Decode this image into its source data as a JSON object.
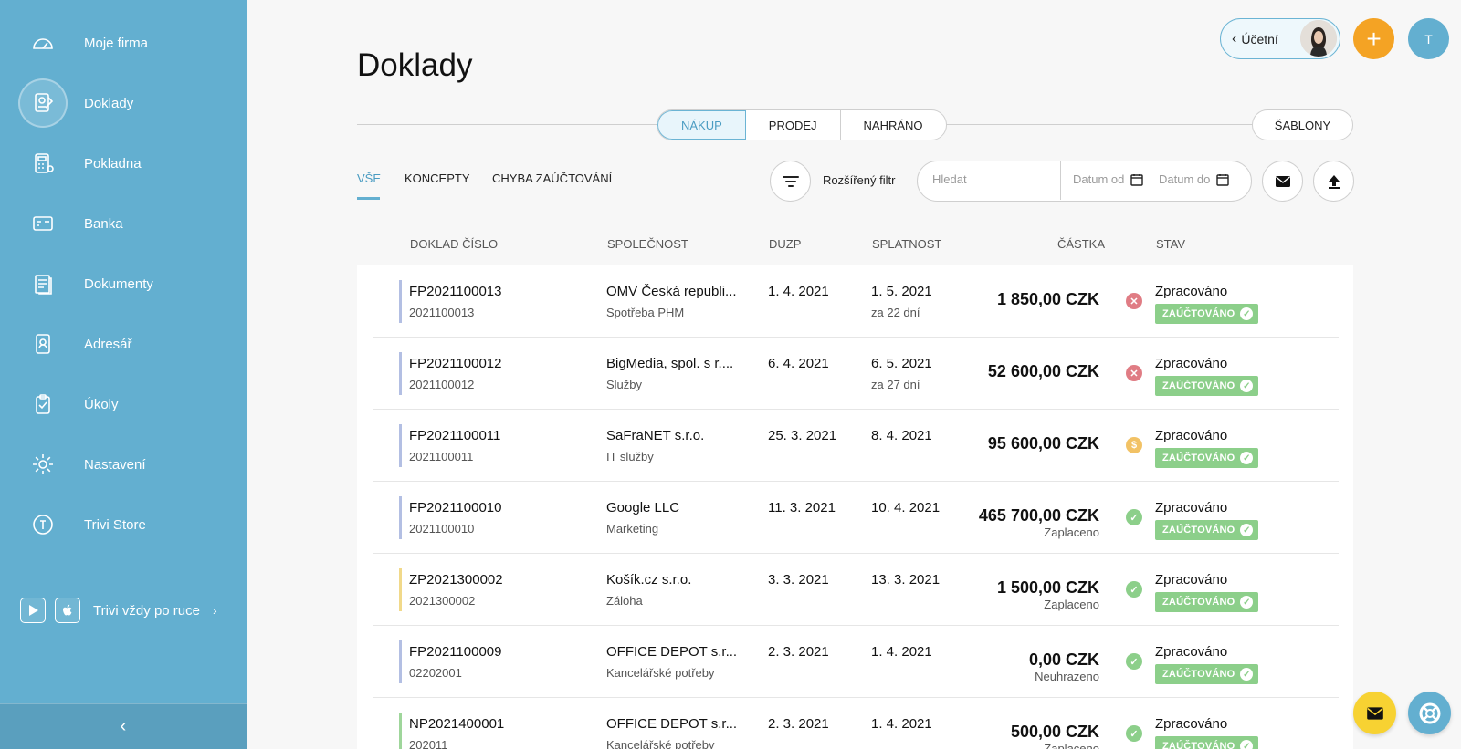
{
  "sidebar": {
    "items": [
      {
        "label": "Moje firma",
        "icon": "gauge-icon"
      },
      {
        "label": "Doklady",
        "icon": "document-icon"
      },
      {
        "label": "Pokladna",
        "icon": "cash-register-icon"
      },
      {
        "label": "Banka",
        "icon": "bank-card-icon"
      },
      {
        "label": "Dokumenty",
        "icon": "files-icon"
      },
      {
        "label": "Adresář",
        "icon": "contact-icon"
      },
      {
        "label": "Úkoly",
        "icon": "clipboard-check-icon"
      },
      {
        "label": "Nastavení",
        "icon": "gear-icon"
      },
      {
        "label": "Trivi Store",
        "icon": "store-icon"
      }
    ],
    "active_index": 1,
    "app_label": "Trivi vždy po ruce",
    "accent": "#63afd0"
  },
  "header": {
    "title": "Doklady",
    "accountant_label": "Účetní",
    "user_initial": "T"
  },
  "segmented": {
    "items": [
      "NÁKUP",
      "PRODEJ",
      "NAHRÁNO"
    ],
    "active": "NÁKUP",
    "templates_label": "ŠABLONY"
  },
  "subtabs": {
    "items": [
      "VŠE",
      "KONCEPTY",
      "CHYBA ZAÚČTOVÁNÍ"
    ],
    "active": "VŠE"
  },
  "filter": {
    "advanced_label": "Rozšířený filtr",
    "search_placeholder": "Hledat",
    "date_from": "Datum od",
    "date_to": "Datum do"
  },
  "table": {
    "headers": [
      "DOKLAD ČÍSLO",
      "SPOLEČNOST",
      "DUZP",
      "SPLATNOST",
      "ČÁSTKA",
      "STAV"
    ],
    "rows": [
      {
        "number": "FP2021100013",
        "sub": "2021100013",
        "company": "OMV Česká republi...",
        "category": "Spotřeba PHM",
        "duzp": "1. 4. 2021",
        "due": "1. 5. 2021",
        "due_sub": "za 22 dní",
        "amount": "1 850,00 CZK",
        "amount_sub": "",
        "pay": "unpaid",
        "status": "Zpracováno",
        "badge": "ZAÚČTOVÁNO",
        "bar": "#b3bfe3"
      },
      {
        "number": "FP2021100012",
        "sub": "2021100012",
        "company": "BigMedia, spol. s r....",
        "category": "Služby",
        "duzp": "6. 4. 2021",
        "due": "6. 5. 2021",
        "due_sub": "za 27 dní",
        "amount": "52 600,00 CZK",
        "amount_sub": "",
        "pay": "unpaid",
        "status": "Zpracováno",
        "badge": "ZAÚČTOVÁNO",
        "bar": "#b3bfe3"
      },
      {
        "number": "FP2021100011",
        "sub": "2021100011",
        "company": "SaFraNET s.r.o.",
        "category": "IT služby",
        "duzp": "25. 3. 2021",
        "due": "8. 4. 2021",
        "due_sub": "",
        "amount": "95 600,00 CZK",
        "amount_sub": "",
        "pay": "partial",
        "status": "Zpracováno",
        "badge": "ZAÚČTOVÁNO",
        "bar": "#b3bfe3"
      },
      {
        "number": "FP2021100010",
        "sub": "2021100010",
        "company": "Google LLC",
        "category": "Marketing",
        "duzp": "11. 3. 2021",
        "due": "10. 4. 2021",
        "due_sub": "",
        "amount": "465 700,00 CZK",
        "amount_sub": "Zaplaceno",
        "pay": "paid",
        "status": "Zpracováno",
        "badge": "ZAÚČTOVÁNO",
        "bar": "#b3bfe3"
      },
      {
        "number": "ZP2021300002",
        "sub": "2021300002",
        "company": "Košík.cz s.r.o.",
        "category": "Záloha",
        "duzp": "3. 3. 2021",
        "due": "13. 3. 2021",
        "due_sub": "",
        "amount": "1 500,00 CZK",
        "amount_sub": "Zaplaceno",
        "pay": "paid",
        "status": "Zpracováno",
        "badge": "ZAÚČTOVÁNO",
        "bar": "#f1d98a"
      },
      {
        "number": "FP2021100009",
        "sub": "02202001",
        "company": "OFFICE DEPOT s.r...",
        "category": "Kancelářské potřeby",
        "duzp": "2. 3. 2021",
        "due": "1. 4. 2021",
        "due_sub": "",
        "amount": "0,00 CZK",
        "amount_sub": "Neuhrazeno",
        "pay": "paid",
        "status": "Zpracováno",
        "badge": "ZAÚČTOVÁNO",
        "bar": "#b3bfe3"
      },
      {
        "number": "NP2021400001",
        "sub": "202011",
        "company": "OFFICE DEPOT s.r...",
        "category": "Kancelářské potřeby",
        "duzp": "2. 3. 2021",
        "due": "1. 4. 2021",
        "due_sub": "",
        "amount": "500,00 CZK",
        "amount_sub": "Zaplaceno",
        "pay": "paid",
        "status": "Zpracováno",
        "badge": "ZAÚČTOVÁNO",
        "bar": "#9fd69b"
      }
    ]
  },
  "colors": {
    "unpaid": "#e07c84",
    "partial": "#f2c265",
    "paid": "#8ccf8a",
    "badge": "#8ccf8a",
    "add_button": "#f4a324",
    "chat_button": "#f7d232"
  }
}
